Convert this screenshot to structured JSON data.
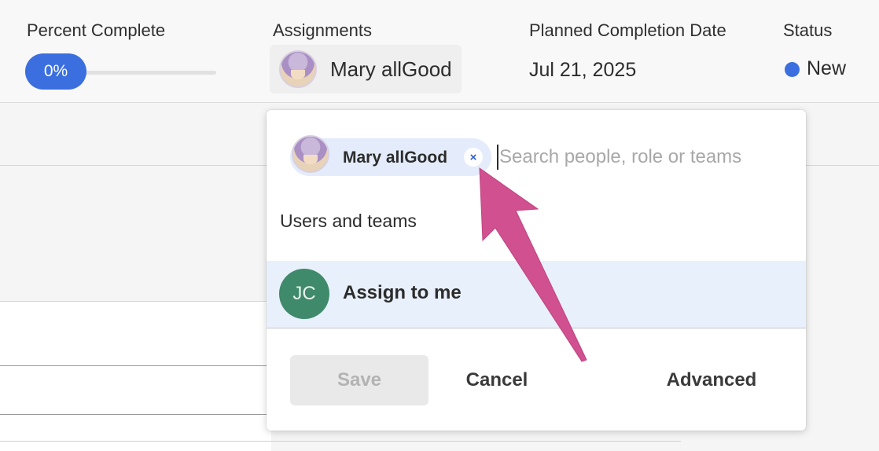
{
  "header": {
    "percent_label": "Percent Complete",
    "percent_value": "0%",
    "percent_fraction": 0,
    "assignments_label": "Assignments",
    "assignee_name": "Mary allGood",
    "planned_date_label": "Planned Completion Date",
    "planned_date_value": "Jul 21, 2025",
    "status_label": "Status",
    "status_value": "New",
    "status_color": "#3b6fe0"
  },
  "popover": {
    "selected_tag": "Mary allGood",
    "remove_glyph": "×",
    "search_placeholder": "Search people, role or teams",
    "section_title": "Users and teams",
    "option_initials": "JC",
    "option_label": "Assign to me",
    "save_label": "Save",
    "cancel_label": "Cancel",
    "advanced_label": "Advanced"
  },
  "colors": {
    "accent": "#3b6fe0",
    "annotation_arrow": "#d1508f",
    "option_avatar": "#3f8a6a"
  }
}
